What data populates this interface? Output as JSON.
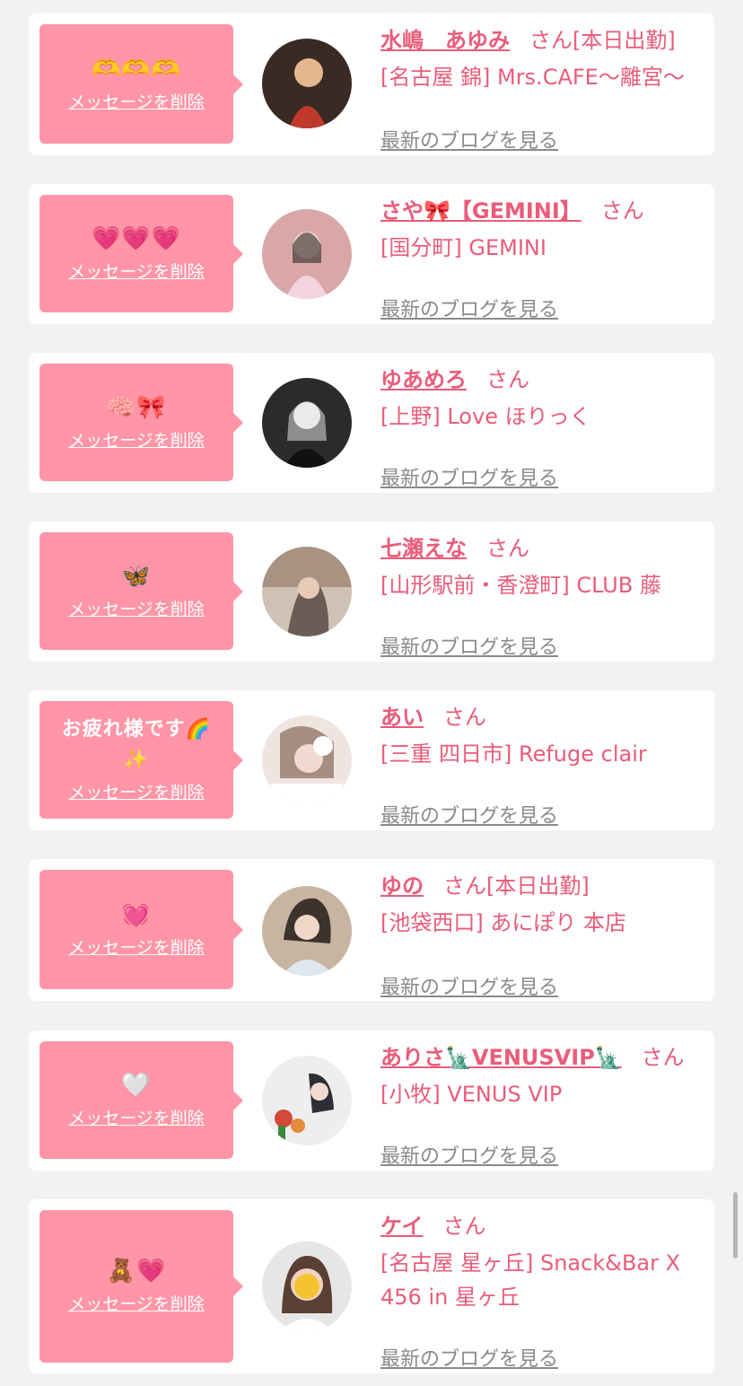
{
  "cards": [
    {
      "message": "🫶🫶🫶",
      "delete_label": "メッセージを削除",
      "name": "水嶋　あゆみ",
      "honorific": "さん",
      "badge": "[本日出勤]",
      "shop": "[名古屋 錦] Mrs.CAFE〜離宮〜",
      "blog_label": "最新のブログを見る",
      "avatar_colors": [
        "#3a2a24",
        "#c0392b"
      ]
    },
    {
      "message": "💗💗💗",
      "delete_label": "メッセージを削除",
      "name": "さや🎀【GEMINI】",
      "honorific": "さん",
      "badge": "",
      "shop": "[国分町] GEMINI",
      "blog_label": "最新のブログを見る",
      "avatar_colors": [
        "#d9a7a7",
        "#f3d3dd"
      ]
    },
    {
      "message": "🧠🎀",
      "delete_label": "メッセージを削除",
      "name": "ゆあめろ",
      "honorific": "さん",
      "badge": "",
      "shop": "[上野] Love ほりっく",
      "blog_label": "最新のブログを見る",
      "avatar_colors": [
        "#2b2b2b",
        "#e9e4e8"
      ]
    },
    {
      "message": "🦋",
      "delete_label": "メッセージを削除",
      "name": "七瀬えな",
      "honorific": "さん",
      "badge": "",
      "shop": "[山形駅前・香澄町] CLUB 藤",
      "blog_label": "最新のブログを見る",
      "avatar_colors": [
        "#6b5d55",
        "#cfc2b4"
      ]
    },
    {
      "message": "お疲れ様です🌈✨",
      "delete_label": "メッセージを削除",
      "name": "あい",
      "honorific": "さん",
      "badge": "",
      "shop": "[三重 四日市] Refuge clair",
      "blog_label": "最新のブログを見る",
      "avatar_colors": [
        "#a78c80",
        "#efe5e0"
      ]
    },
    {
      "message": "💓",
      "delete_label": "メッセージを削除",
      "name": "ゆの",
      "honorific": "さん",
      "badge": "[本日出勤]",
      "shop": "[池袋西口] あにぽり 本店",
      "blog_label": "最新のブログを見る",
      "avatar_colors": [
        "#3b332c",
        "#c7b5a1"
      ]
    },
    {
      "message": "🤍",
      "delete_label": "メッセージを削除",
      "name": "ありさ🗽VENUSVIP🗽",
      "honorific": "さん",
      "badge": "",
      "shop": "[小牧] VENUS VIP",
      "blog_label": "最新のブログを見る",
      "avatar_colors": [
        "#d4493a",
        "#eeeeee"
      ]
    },
    {
      "message": "🧸💗",
      "delete_label": "メッセージを削除",
      "name": "ケイ",
      "honorific": "さん",
      "badge": "",
      "shop": "[名古屋 星ヶ丘] Snack&Bar X 456 in 星ヶ丘",
      "blog_label": "最新のブログを見る",
      "avatar_colors": [
        "#e6e6e6",
        "#f4c430"
      ]
    }
  ]
}
